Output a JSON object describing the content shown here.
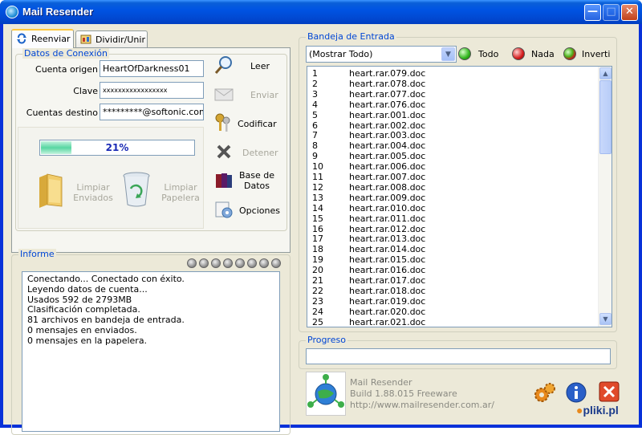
{
  "window": {
    "title": "Mail Resender"
  },
  "tabs": [
    {
      "label": "Reenviar",
      "active": true
    },
    {
      "label": "Dividir/Unir",
      "active": false
    }
  ],
  "connection": {
    "group_label": "Datos de Conexión",
    "account_label": "Cuenta origen",
    "account_value": "HeartOfDarkness01",
    "password_label": "Clave",
    "password_value": "xxxxxxxxxxxxxxxxx",
    "dest_label": "Cuentas destino",
    "dest_value": "*********@softonic.com"
  },
  "progress_panel": {
    "percent_text": "21%",
    "fraction": 0.21
  },
  "big_buttons": {
    "clear_sent": "Limpiar\nEnviados",
    "clear_trash": "Limpiar\nPapelera"
  },
  "actions": {
    "read": "Leer",
    "send": "Enviar",
    "encode": "Codificar",
    "stop": "Detener",
    "database": "Base de\nDatos",
    "options": "Opciones"
  },
  "report": {
    "group_label": "Informe",
    "lines": [
      "Conectando... Conectado con éxito.",
      "Leyendo datos de cuenta...",
      "Usados 592 de 2793MB",
      "Clasificación completada.",
      "81 archivos en bandeja de entrada.",
      "0 mensajes en enviados.",
      "0 mensajes en la papelera."
    ]
  },
  "inbox": {
    "group_label": "Bandeja de Entrada",
    "filter_value": "(Mostrar Todo)",
    "select_all": "Todo",
    "select_none": "Nada",
    "invert": "Invertir",
    "items": [
      {
        "num": "1",
        "name": "heart.rar.079.doc"
      },
      {
        "num": "2",
        "name": "heart.rar.078.doc"
      },
      {
        "num": "3",
        "name": "heart.rar.077.doc"
      },
      {
        "num": "4",
        "name": "heart.rar.076.doc"
      },
      {
        "num": "5",
        "name": "heart.rar.001.doc"
      },
      {
        "num": "6",
        "name": "heart.rar.002.doc"
      },
      {
        "num": "7",
        "name": "heart.rar.003.doc"
      },
      {
        "num": "8",
        "name": "heart.rar.004.doc"
      },
      {
        "num": "9",
        "name": "heart.rar.005.doc"
      },
      {
        "num": "10",
        "name": "heart.rar.006.doc"
      },
      {
        "num": "11",
        "name": "heart.rar.007.doc"
      },
      {
        "num": "12",
        "name": "heart.rar.008.doc"
      },
      {
        "num": "13",
        "name": "heart.rar.009.doc"
      },
      {
        "num": "14",
        "name": "heart.rar.010.doc"
      },
      {
        "num": "15",
        "name": "heart.rar.011.doc"
      },
      {
        "num": "16",
        "name": "heart.rar.012.doc"
      },
      {
        "num": "17",
        "name": "heart.rar.013.doc"
      },
      {
        "num": "18",
        "name": "heart.rar.014.doc"
      },
      {
        "num": "19",
        "name": "heart.rar.015.doc"
      },
      {
        "num": "20",
        "name": "heart.rar.016.doc"
      },
      {
        "num": "21",
        "name": "heart.rar.017.doc"
      },
      {
        "num": "22",
        "name": "heart.rar.018.doc"
      },
      {
        "num": "23",
        "name": "heart.rar.019.doc"
      },
      {
        "num": "24",
        "name": "heart.rar.020.doc"
      },
      {
        "num": "25",
        "name": "heart.rar.021.doc"
      }
    ]
  },
  "progress": {
    "group_label": "Progreso"
  },
  "about": {
    "name": "Mail Resender",
    "build": "Build 1.88.015 Freeware",
    "url": "http://www.mailresender.com.ar/"
  },
  "watermark": "pliki.pl"
}
